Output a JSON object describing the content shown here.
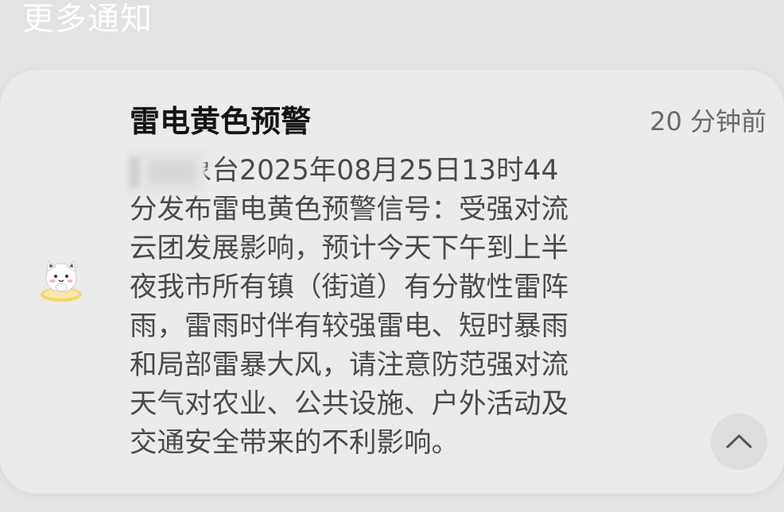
{
  "section": {
    "title": "更多通知"
  },
  "notification": {
    "app_icon": "cat-sticker-icon",
    "title": "雷电黄色预警",
    "time": "20 分钟前",
    "body": "市气象台2025年08月25日13时44\n分发布雷电黄色预警信号：受强对流\n云团发展影响，预计今天下午到上半\n夜我市所有镇（街道）有分散性雷阵\n雨，雷雨时伴有较强雷电、短时暴雨\n和局部雷暴大风，请注意防范强对流\n天气对农业、公共设施、户外活动及\n交通安全带来的不利影响。",
    "collapse_icon": "chevron-up-icon"
  },
  "colors": {
    "background": "#e3e3e5",
    "card": "#ebebec",
    "title": "#141414",
    "body": "#4a4a4a",
    "time": "#6a6a6a"
  }
}
